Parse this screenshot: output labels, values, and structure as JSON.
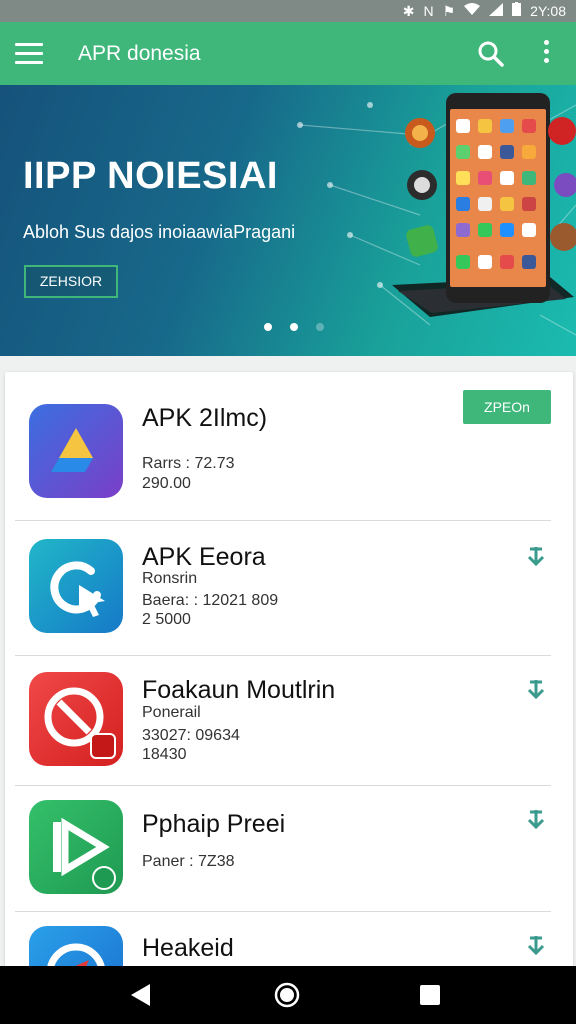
{
  "status": {
    "time": "2Y:08"
  },
  "appbar": {
    "title": "APR donesia"
  },
  "banner": {
    "title": "IIPP NOIESIAI",
    "subtitle": "Abloh Sus dajos inoiaawiaPragani",
    "button_label": "ZEHSIOR",
    "dots": 3,
    "active_dot": 1
  },
  "apps": [
    {
      "name": "APK 2Ilmc)",
      "line1": "Rarrs : 72.73",
      "line2": "290.00",
      "action": "install",
      "action_label": "ZPEOn"
    },
    {
      "name": "APK Eeora",
      "line1": "Ronsrin",
      "line2": "Baera: : 12021 809",
      "line3": "2 5000",
      "action": "download"
    },
    {
      "name": "Foakaun Moutlrin",
      "line1": "Ponerail",
      "line2": "33027: 09634",
      "line3": "18430",
      "action": "download"
    },
    {
      "name": "Pphaip Preei",
      "line1": "Paner : 7Z38",
      "action": "download"
    },
    {
      "name": "Heakeid",
      "action": "download"
    }
  ],
  "colors": {
    "accent": "#3fb77b",
    "banner_dark": "#16527b",
    "banner_light": "#1bbbb0"
  }
}
